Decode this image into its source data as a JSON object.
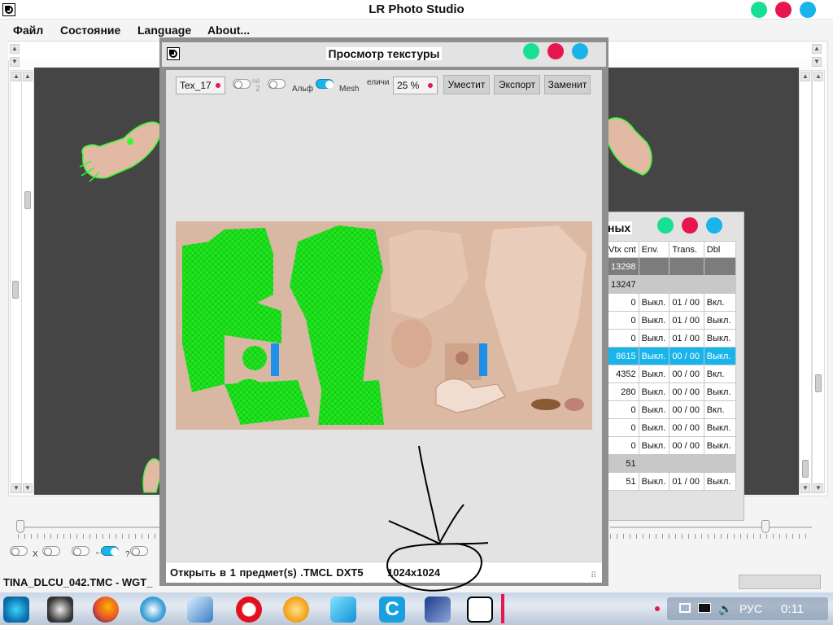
{
  "app": {
    "title": "LR Photo Studio",
    "colors": {
      "green": "#18e092",
      "red": "#e8164e",
      "blue": "#18b4ea"
    }
  },
  "menu": [
    {
      "label": "Файл"
    },
    {
      "label": "Состояние"
    },
    {
      "label": "Language"
    },
    {
      "label": "About..."
    }
  ],
  "info_panel": {
    "title_fragment": "ных",
    "columns": [
      "Vtx cnt",
      "Env.",
      "Trans.",
      "Dbl"
    ],
    "rows": [
      {
        "vtx": "13298",
        "env": "",
        "trans": "",
        "dbl": ""
      },
      {
        "vtx": "13247",
        "env": "",
        "trans": "",
        "dbl": ""
      },
      {
        "vtx": "0",
        "env": "Выкл.",
        "trans": "01 / 00",
        "dbl": "Вкл."
      },
      {
        "vtx": "0",
        "env": "Выкл.",
        "trans": "01 / 00",
        "dbl": "Выкл."
      },
      {
        "vtx": "0",
        "env": "Выкл.",
        "trans": "01 / 00",
        "dbl": "Выкл."
      },
      {
        "vtx": "8615",
        "env": "Выкл.",
        "trans": "00 / 00",
        "dbl": "Выкл."
      },
      {
        "vtx": "4352",
        "env": "Выкл.",
        "trans": "00 / 00",
        "dbl": "Вкл."
      },
      {
        "vtx": "280",
        "env": "Выкл.",
        "trans": "00 / 00",
        "dbl": "Выкл."
      },
      {
        "vtx": "0",
        "env": "Выкл.",
        "trans": "00 / 00",
        "dbl": "Вкл."
      },
      {
        "vtx": "0",
        "env": "Выкл.",
        "trans": "00 / 00",
        "dbl": "Выкл."
      },
      {
        "vtx": "0",
        "env": "Выкл.",
        "trans": "00 / 00",
        "dbl": "Выкл."
      },
      {
        "vtx": "51",
        "env": "",
        "trans": "",
        "dbl": ""
      },
      {
        "vtx": "51",
        "env": "Выкл.",
        "trans": "01 / 00",
        "dbl": "Выкл."
      }
    ]
  },
  "main_controls": {
    "toggle_labels": [
      "X",
      "←",
      "?"
    ]
  },
  "status": {
    "file": "TINA_DLCU_042.TMC - WGT_"
  },
  "texture_dialog": {
    "title": "Просмотр текстуры",
    "texture_select": "Tex_17",
    "toggle_2nd": "nd",
    "toggle_2nd_sub": "2",
    "toggle_alpha": "Альф",
    "toggle_mesh": "Mesh",
    "zoom_label": "еличи",
    "zoom_value": "25 %",
    "buttons": {
      "fit": "Уместит",
      "export": "Экспорт",
      "replace": "Заменит"
    },
    "status_text": "Открыть в 1 предмет(s)  .TMCL  DXT5",
    "size": "1024x1024"
  },
  "taskbar": {
    "language": "РУС",
    "time": "0:11",
    "apps": [
      "biohazard-app",
      "x-app",
      "firefox",
      "wave-app",
      "cubes-app",
      "opera",
      "photo-app",
      "word-app",
      "c-app",
      "monitor-app",
      "lr-photo-studio"
    ]
  }
}
